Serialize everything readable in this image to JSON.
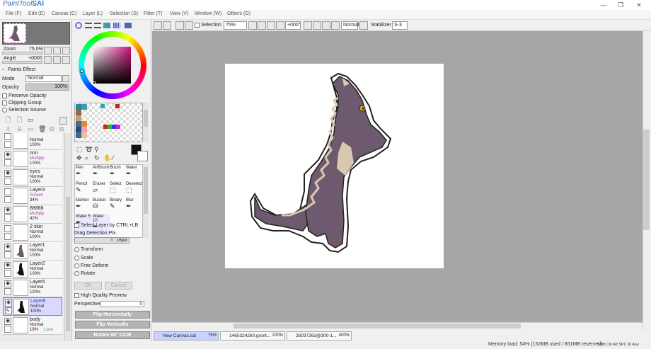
{
  "app": {
    "title_prefix": "PaintTool",
    "title_brand": "SAI"
  },
  "window_buttons": {
    "minimize": "—",
    "restore": "❐",
    "close": "✕"
  },
  "menu": [
    "File (F)",
    "Edit (E)",
    "Canvas (C)",
    "Layer (L)",
    "Selection (S)",
    "Filter (T)",
    "View (V)",
    "Window (W)",
    "Others (O)"
  ],
  "toolbar": {
    "selection_label": "Selection",
    "zoom_value": "75%",
    "angle_value": "+000°",
    "mode_value": "Normal",
    "stabilizer_label": "Stabilizer",
    "stabilizer_value": "S-3"
  },
  "navigator": {
    "zoom_label": "Zoom",
    "zoom_value": "75.0%",
    "angle_label": "Angle",
    "angle_value": "+0000"
  },
  "layer_panel": {
    "paints_effect": "Paints Effect",
    "mode_label": "Mode",
    "mode_value": "Normal",
    "opacity_label": "Opacity",
    "opacity_value": "100%",
    "preserve_opacity": "Preserve Opacity",
    "clipping_group": "Clipping Group",
    "selection_source": "Selection Source"
  },
  "layers": [
    {
      "name": "",
      "mode": "Normal",
      "opacity": "100%",
      "extra": ""
    },
    {
      "name": "nnn",
      "mode": "Multiply",
      "opacity": "100%",
      "extra": ""
    },
    {
      "name": "eyes",
      "mode": "Normal",
      "opacity": "100%",
      "extra": ""
    },
    {
      "name": "Layer3",
      "mode": "Screen",
      "opacity": "34%",
      "extra": ""
    },
    {
      "name": "88888",
      "mode": "Multiply",
      "opacity": "42%",
      "extra": ""
    },
    {
      "name": "2 skin",
      "mode": "Normal",
      "opacity": "100%",
      "extra": ""
    },
    {
      "name": "Layer1",
      "mode": "Normal",
      "opacity": "100%",
      "extra": ""
    },
    {
      "name": "Layer2",
      "mode": "Normal",
      "opacity": "100%",
      "extra": ""
    },
    {
      "name": "Layer5",
      "mode": "Normal",
      "opacity": "100%",
      "extra": ""
    },
    {
      "name": "Layer6",
      "mode": "Normal",
      "opacity": "100%",
      "extra": ""
    },
    {
      "name": "body",
      "mode": "Normal",
      "opacity": "19%",
      "extra": "Lock"
    }
  ],
  "tools": {
    "row1": [
      "Pen",
      "AirBrush",
      "Brush",
      "Water"
    ],
    "row2": [
      "Pencil",
      "Eraser",
      "Select",
      "Deselect"
    ],
    "row3": [
      "Marker",
      "Bucket",
      "Binary",
      "Blur"
    ],
    "row4": [
      "Water 5",
      "Water 10"
    ]
  },
  "select_options": {
    "select_layer": "Select Layer by CTRL+LB",
    "drag_detection": "Drag Detection Pix.",
    "drag_value": "16pix",
    "transform": "Transform",
    "scale": "Scale",
    "free_deform": "Free Deform",
    "rotate": "Rotate",
    "ok": "OK",
    "cancel": "Cancel",
    "high_quality": "High Quality Preview",
    "perspective_label": "Perspective",
    "perspective_value": "0",
    "flip_h": "Flip Horizontally",
    "flip_v": "Flip Vertically",
    "rotate_ccw": "Rotate 90° CCW"
  },
  "doc_tabs": [
    {
      "name": "New Canvas.sai",
      "zoom": "75%"
    },
    {
      "name": "1465324260.gront...",
      "zoom": "200%"
    },
    {
      "name": "26037263@300-1...",
      "zoom": "400%"
    }
  ],
  "status": {
    "memory": "Memory load: 54% (152MB used / 851MB reserved)",
    "keys": "Shift Ctrl Alt SPC ⚙ Any"
  },
  "colors": {
    "accent": "#3a78c0",
    "selected_layer": "#d9d9ff",
    "canvas_bg": "#a6a6a6",
    "character": "#6e5a6e"
  }
}
